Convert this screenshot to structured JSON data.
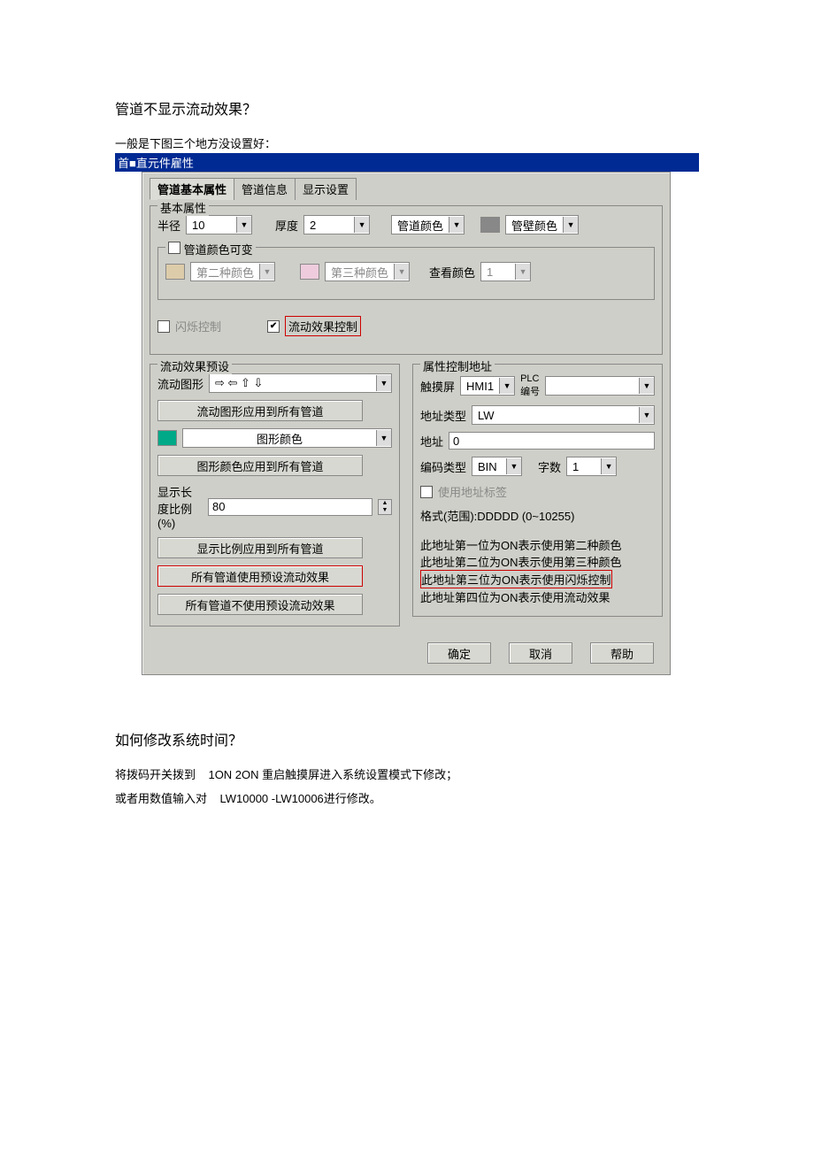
{
  "question": "管道不显示流动效果？",
  "subline": "一般是下图三个地方没设置好：",
  "windowTitle": "首■直元件雇性",
  "tabs": {
    "t1": "管道基本属性",
    "t2": "管道信息",
    "t3": "显示设置"
  },
  "grpBasic": {
    "legend": "基本属性",
    "radius": "半径",
    "radiusVal": "10",
    "thick": "厚度",
    "thickVal": "2",
    "pipeColor": "管道颜色",
    "wallColor": "管壁颜色",
    "colorVar": "管道颜色可变",
    "color2": "第二种颜色",
    "color3": "第三种颜色",
    "viewColor": "查看颜色",
    "viewVal": "1",
    "flash": "闪烁控制",
    "flow": "流动效果控制"
  },
  "grpPreset": {
    "legend": "流动效果预设",
    "flowShape": "流动图形",
    "flowVal": "⇨ ⇦ ⇧ ⇩",
    "applyShape": "流动图形应用到所有管道",
    "shapeColor": "图形颜色",
    "applyColor": "图形颜色应用到所有管道",
    "lenRatio": "显示长度比例(%)",
    "lenVal": "80",
    "applyRatio": "显示比例应用到所有管道",
    "allUse": "所有管道使用预设流动效果",
    "allNotUse": "所有管道不使用预设流动效果"
  },
  "grpAddr": {
    "legend": "属性控制地址",
    "touch": "触摸屏",
    "touchVal": "HMI1",
    "plc": "PLC\n编号",
    "addrType": "地址类型",
    "addrTypeVal": "LW",
    "addr": "地址",
    "addrVal": "0",
    "codeType": "编码类型",
    "codeVal": "BIN",
    "wordCnt": "字数",
    "wordVal": "1",
    "useTag": "使用地址标签",
    "fmt": "格式(范围):DDDDD (0~10255)",
    "l1": "此地址第一位为ON表示使用第二种颜色",
    "l2": "此地址第二位为ON表示使用第三种颜色",
    "l3": "此地址第三位为ON表示使用闪烁控制",
    "l4": "此地址第四位为ON表示使用流动效果"
  },
  "dlgbtn": {
    "ok": "确定",
    "cancel": "取消",
    "help": "帮助"
  },
  "q2": "如何修改系统时间？",
  "q2l1a": "将拨码开关拨到",
  "q2l1b": "1ON 2ON 重启触摸屏进入系统设置模式下修改；",
  "q2l2a": "或者用数值输入对",
  "q2l2b": "LW10000 -LW10006进行修改。"
}
